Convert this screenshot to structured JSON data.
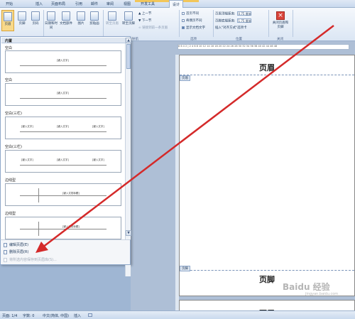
{
  "ribbon": {
    "tabs": [
      "开始",
      "插入",
      "页面布局",
      "引用",
      "邮件",
      "审阅",
      "视图",
      "开发工具",
      "设计"
    ],
    "context_group": "页眉和页脚工具",
    "buttons": {
      "header": "页眉",
      "footer": "页脚",
      "page_number": "页码",
      "date_time": "日期和时间",
      "doc_parts": "文档部件",
      "picture": "图片",
      "clip_art": "剪贴画",
      "goto_header": "转至页眉",
      "goto_footer": "转至页脚",
      "prev_section": "上一节",
      "next_section": "下一节",
      "link_prev": "链接到前一条页眉",
      "diff_first_page": "首页不同",
      "diff_odd_even": "奇偶页不同",
      "show_doc_text": "显示文档文字",
      "header_top_label": "页眉顶端距离:",
      "header_top_value": "0.75 厘米",
      "footer_bottom_label": "页脚底端距离:",
      "footer_bottom_value": "1.75 厘米",
      "insert_align_tab": "插入\"对齐方式\"选项卡",
      "close_hf": "关闭页眉和页脚"
    },
    "groups": {
      "nav": "导航",
      "options": "选项",
      "position": "位置",
      "close": "关闭"
    }
  },
  "gallery": {
    "header": "内置",
    "items": [
      {
        "label": "空白",
        "placeholders": [
          "[键入文字]"
        ]
      },
      {
        "label": "空白",
        "placeholders": [
          "[键入文字]"
        ]
      },
      {
        "label": "空白(三栏)",
        "placeholders": [
          "[键入文字]",
          "[键入文字]",
          "[键入文字]"
        ]
      },
      {
        "label": "空白(三栏)",
        "placeholders": [
          "[键入文字]",
          "[键入文字]",
          "[键入文字]"
        ]
      },
      {
        "label": "边线型",
        "placeholders": [
          "[键入文档标题]"
        ]
      },
      {
        "label": "边线型",
        "placeholders": [
          "[键入文档标题]"
        ]
      }
    ],
    "menu": {
      "edit": "编辑页眉(E)",
      "delete": "删除页眉(R)",
      "save_selection": "将所选内容保存到页眉库(S)..."
    }
  },
  "document": {
    "ruler_marks": "8  6  4  2  |  2  4  6  8  10  12  14  16  18  20  22  24  26  28  30  32  34  36  38  40  42  44  46  48",
    "page1_header_tag": "页眉",
    "page1_header_text": "页眉",
    "page1_footer_tag": "页脚",
    "page1_footer_text": "页脚",
    "page2_header_text": "页眉"
  },
  "statusbar": {
    "page": "页面: 1/4",
    "words": "字数: 0",
    "language": "中文(简体, 中国)",
    "mode": "插入"
  },
  "watermark": {
    "brand": "Baidu 经验",
    "url": "jingyan.baidu.com"
  },
  "colors": {
    "arrow": "#d42a2a",
    "ribbon_accent": "#f8d98a",
    "close_button": "#d9443a"
  }
}
